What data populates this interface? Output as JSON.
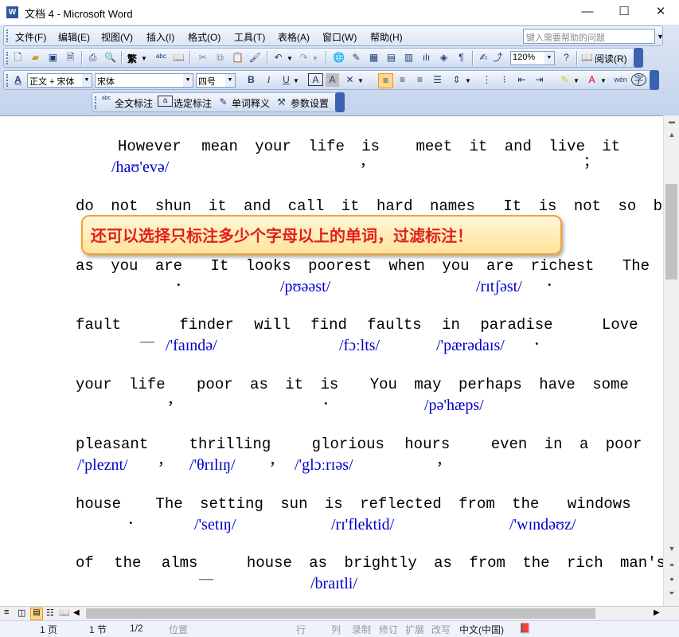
{
  "window": {
    "title": "文档 4 - Microsoft Word",
    "icon": "word-app-icon"
  },
  "menu": [
    "文件(F)",
    "编辑(E)",
    "视图(V)",
    "插入(I)",
    "格式(O)",
    "工具(T)",
    "表格(A)",
    "窗口(W)",
    "帮助(H)"
  ],
  "help_placeholder": "键入需要帮助的问题",
  "toolbar": {
    "zoom": "120%",
    "read_label": "阅读(R)",
    "trad_char": "繁"
  },
  "format": {
    "style": "正文 + 宋体",
    "font": "宋体",
    "size": "四号"
  },
  "addin": {
    "full_mark": "全文标注",
    "selected_mark": "选定标注",
    "word_def": "单词释义",
    "settings": "参数设置"
  },
  "callout": "还可以选择只标注多少个字母以上的单词，过滤标注！",
  "document": {
    "lines": [
      {
        "words": [
          "However",
          "mean",
          "your",
          "life",
          "is",
          "meet",
          "it",
          "and",
          "live",
          "it"
        ]
      },
      {
        "words": [
          "do",
          "not",
          "shun",
          "it",
          "and",
          "call",
          "it",
          "hard",
          "names",
          "It",
          "is",
          "not",
          "so",
          "bad"
        ]
      },
      {
        "words": [
          "as",
          "you",
          "are",
          "It",
          "looks",
          "poorest",
          "when",
          "you",
          "are",
          "richest",
          "The"
        ]
      },
      {
        "words": [
          "fault",
          "finder",
          "will",
          "find",
          "faults",
          "in",
          "paradise",
          "Love"
        ]
      },
      {
        "words": [
          "your",
          "life",
          "poor",
          "as",
          "it",
          "is",
          "You",
          "may",
          "perhaps",
          "have",
          "some"
        ]
      },
      {
        "words": [
          "pleasant",
          "thrilling",
          "glorious",
          "hours",
          "even",
          "in",
          "a",
          "poor"
        ]
      },
      {
        "words": [
          "house",
          "The",
          "setting",
          "sun",
          "is",
          "reflected",
          "from",
          "the",
          "windows"
        ]
      },
      {
        "words": [
          "of",
          "the",
          "alms",
          "house",
          "as",
          "brightly",
          "as",
          "from",
          "the",
          "rich",
          "man's"
        ]
      }
    ],
    "phonetics": [
      "/haʊ'evə/",
      "/pʊəəst/",
      "/rɪtʃəst/",
      "/'faɪndə/",
      "/fɔːlts/",
      "/'pærədaɪs/",
      "/pə'hæps/",
      "/'pleznt/",
      "/'θrɪlɪŋ/",
      "/'glɔːrɪəs/",
      "/'setɪŋ/",
      "/rɪ'flektid/",
      "/'wɪndəʊz/",
      "/braɪtli/"
    ],
    "punct": {
      "comma": "，",
      "period": "．",
      "semicolon": "；",
      "dash": "＿"
    }
  },
  "status": {
    "page": "1 页",
    "section": "1 节",
    "pages": "1/2",
    "position": "位置",
    "row": "行",
    "col": "列",
    "rec": "录制",
    "trk": "修订",
    "ext": "扩展",
    "ovr": "改写",
    "lang": "中文(中国)"
  },
  "colors": {
    "accent": "#2b579a",
    "phonetic": "#0000cc",
    "callout_text": "#e0201a",
    "callout_border": "#f2a43a"
  }
}
